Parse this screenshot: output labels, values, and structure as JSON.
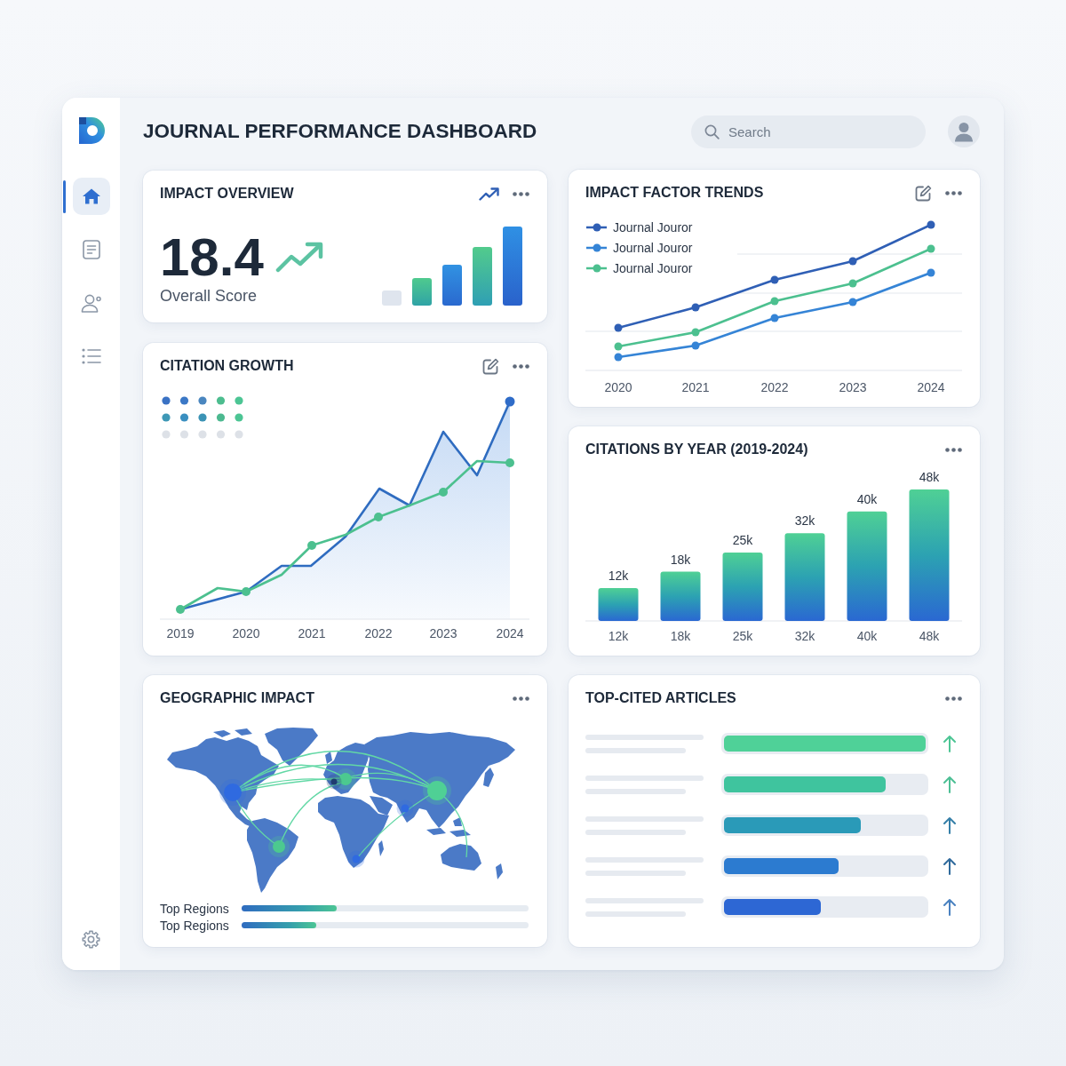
{
  "window": {
    "title": "JOURNAL PERFORMANCE DASHBOARD"
  },
  "sidebar": {
    "items": [
      {
        "selected": true
      },
      {
        "selected": false
      },
      {
        "selected": false
      },
      {
        "selected": false
      }
    ]
  },
  "search": {
    "placeholder": "Search"
  },
  "impact_overview": {
    "title": "IMPACT OVERVIEW",
    "value": "18.4",
    "label": "Overall Score"
  },
  "impact_factor_trends": {
    "title": "IMPACT FACTOR TRENDS",
    "legend": [
      {
        "label": "Journal Jouror",
        "color": "#2f5fb5"
      },
      {
        "label": "Journal Jouror",
        "color": "#3584d6"
      },
      {
        "label": "Journal Jouror",
        "color": "#4cc08f"
      }
    ],
    "x_labels": [
      "2020",
      "2021",
      "2022",
      "2023",
      "2024"
    ]
  },
  "citation_growth": {
    "title": "CITATION GROWTH",
    "x_labels": [
      "2019",
      "2020",
      "2021",
      "2022",
      "2023",
      "2024"
    ]
  },
  "citations_by_year": {
    "title": "CITATIONS BY YEAR (2019-2024)",
    "chart_data": {
      "type": "bar",
      "categories": [
        "12k",
        "18k",
        "25k",
        "32k",
        "40k",
        "48k"
      ],
      "values": [
        12,
        18,
        25,
        32,
        40,
        48
      ],
      "value_labels": [
        "12k",
        "18k",
        "25k",
        "32k",
        "40k",
        "48k"
      ]
    }
  },
  "geographic_impact": {
    "title": "GEOGRAPHIC IMPACT",
    "regions": [
      {
        "label": "Top Regions",
        "level": 0.33
      },
      {
        "label": "Top Regions",
        "level": 0.26
      }
    ]
  },
  "top_cited_articles": {
    "title": "TOP-CITED ARTICLES",
    "articles": [
      {
        "level": 1
      },
      {
        "level": 0.8
      },
      {
        "level": 0.68
      },
      {
        "level": 0.57
      },
      {
        "level": 0.48
      }
    ]
  }
}
